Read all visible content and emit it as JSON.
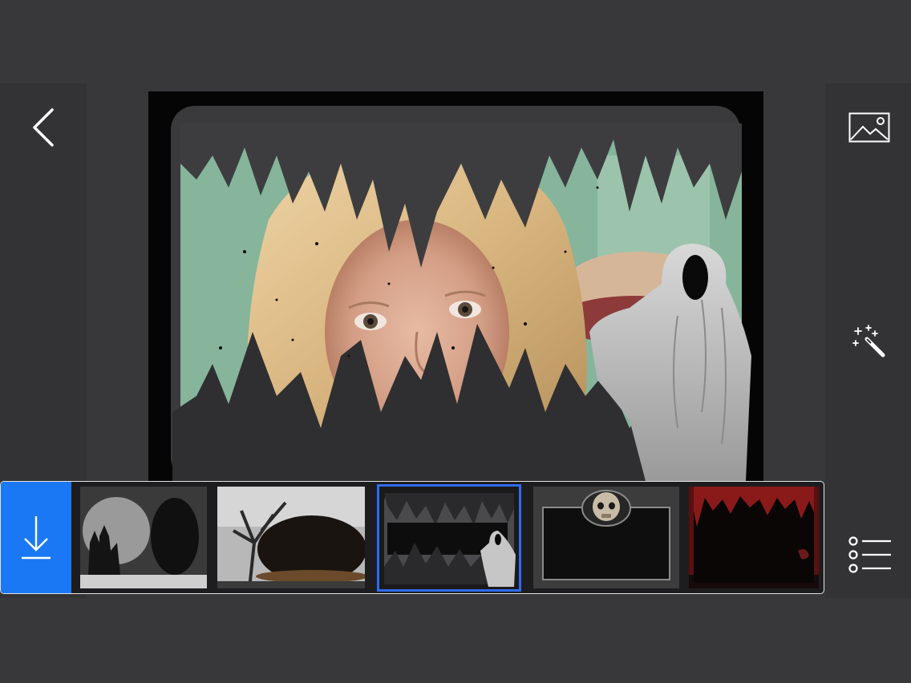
{
  "toolbar": {
    "back": {
      "icon": "chevron-left-icon"
    },
    "gallery": {
      "icon": "image-icon"
    },
    "effects": {
      "icon": "magic-wand-icon"
    },
    "menu": {
      "icon": "list-icon"
    },
    "save": {
      "icon": "download-icon",
      "color": "#1a78f4"
    }
  },
  "frames": {
    "selected_index": 2,
    "highlight_color": "#2d6cf2",
    "items": [
      {
        "theme": "haunted-castle-moon"
      },
      {
        "theme": "foggy-dead-tree"
      },
      {
        "theme": "dark-forest-ghost"
      },
      {
        "theme": "skull-frame"
      },
      {
        "theme": "blood-drip"
      }
    ]
  },
  "colors": {
    "background": "#38383a",
    "panel": "#333335",
    "strip_border": "#e4e4e4"
  }
}
